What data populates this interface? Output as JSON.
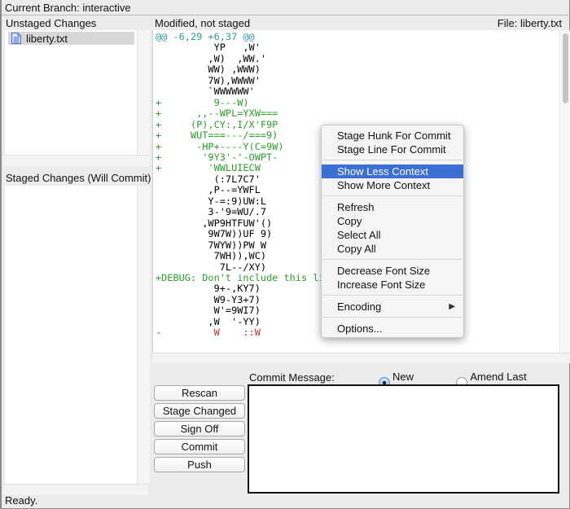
{
  "branch": {
    "label": "Current Branch: interactive"
  },
  "unstaged": {
    "title": "Unstaged Changes",
    "files": [
      {
        "name": "liberty.txt",
        "icon": "text-file-icon",
        "selected": true
      }
    ]
  },
  "staged": {
    "title": "Staged Changes (Will Commit)",
    "files": []
  },
  "diff": {
    "status": "Modified, not staged",
    "file_label": "File: liberty.txt",
    "lines": [
      {
        "type": "hunk",
        "text": "@@ -6,29 +6,37 @@"
      },
      {
        "type": "ctx",
        "text": "          YP   ,W'"
      },
      {
        "type": "ctx",
        "text": "         ,W)  ,WW.'"
      },
      {
        "type": "ctx",
        "text": "         WW) ,WWW)"
      },
      {
        "type": "ctx",
        "text": "         7W),WWWW'"
      },
      {
        "type": "ctx",
        "text": "         `WWWWWW'"
      },
      {
        "type": "add",
        "text": "+         9---W)"
      },
      {
        "type": "add",
        "text": "+      ,,--WPL=YXW==="
      },
      {
        "type": "add",
        "text": "+     (P),CY:,I/X'F9P"
      },
      {
        "type": "add",
        "text": "+     WUT===---/===9)"
      },
      {
        "type": "add",
        "text": "+      -HP+----Y(C=9W)"
      },
      {
        "type": "add",
        "text": "+       '9Y3'-'-OWPT-"
      },
      {
        "type": "add",
        "text": "+        'WWLUIECW"
      },
      {
        "type": "ctx",
        "text": "          (:7L7C7'"
      },
      {
        "type": "ctx",
        "text": "         ,P--=YWFL"
      },
      {
        "type": "ctx",
        "text": "         Y-=:9)UW:L"
      },
      {
        "type": "ctx",
        "text": "         3-'9=WU/.7"
      },
      {
        "type": "ctx",
        "text": "        ,WP9HTFUW'()"
      },
      {
        "type": "ctx",
        "text": "         9W7W))UF 9)"
      },
      {
        "type": "ctx",
        "text": "         7WYW))PW W"
      },
      {
        "type": "ctx",
        "text": "          7WH)),WC)"
      },
      {
        "type": "ctx",
        "text": "           7L--/XY)"
      },
      {
        "type": "add",
        "text": "+DEBUG: Don't include this line."
      },
      {
        "type": "ctx",
        "text": "          9+-,KY7)"
      },
      {
        "type": "ctx",
        "text": "          W9-Y3+7)"
      },
      {
        "type": "ctx",
        "text": "          W'=9WI7)"
      },
      {
        "type": "ctx",
        "text": "         ,W  '-YY)"
      },
      {
        "type": "del",
        "text": "-         W    ::W"
      }
    ]
  },
  "context_menu": {
    "groups": [
      [
        {
          "label": "Stage Hunk For Commit"
        },
        {
          "label": "Stage Line For Commit"
        }
      ],
      [
        {
          "label": "Show Less Context",
          "selected": true
        },
        {
          "label": "Show More Context"
        }
      ],
      [
        {
          "label": "Refresh"
        },
        {
          "label": "Copy"
        },
        {
          "label": "Select All"
        },
        {
          "label": "Copy All"
        }
      ],
      [
        {
          "label": "Decrease Font Size"
        },
        {
          "label": "Increase Font Size"
        }
      ],
      [
        {
          "label": "Encoding",
          "submenu": true
        }
      ],
      [
        {
          "label": "Options..."
        }
      ]
    ],
    "submenu_arrow": "▶"
  },
  "actions": {
    "rescan": "Rescan",
    "stage_changed": "Stage Changed",
    "sign_off": "Sign Off",
    "commit": "Commit",
    "push": "Push"
  },
  "commit": {
    "label": "Commit Message:",
    "message": "",
    "mode_options": [
      {
        "label": "New Commit",
        "checked": true
      },
      {
        "label": "Amend Last Commit",
        "checked": false
      }
    ]
  },
  "status": {
    "text": "Ready."
  }
}
